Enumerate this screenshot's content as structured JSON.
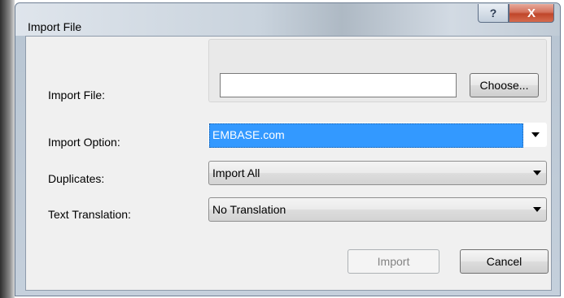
{
  "window": {
    "title": "Import File",
    "help_glyph": "?",
    "close_glyph": "X"
  },
  "form": {
    "import_file_label": "Import File:",
    "import_file_value": "",
    "choose_label": "Choose...",
    "import_option_label": "Import Option:",
    "import_option_value": "EMBASE.com",
    "duplicates_label": "Duplicates:",
    "duplicates_value": "Import All",
    "text_translation_label": "Text Translation:",
    "text_translation_value": "No Translation"
  },
  "buttons": {
    "import_label": "Import",
    "import_enabled": false,
    "cancel_label": "Cancel"
  },
  "colors": {
    "selection": "#3399ff",
    "close_button": "#c0462a"
  },
  "icons": [
    "help-icon",
    "close-icon",
    "dropdown-arrow-icon"
  ]
}
